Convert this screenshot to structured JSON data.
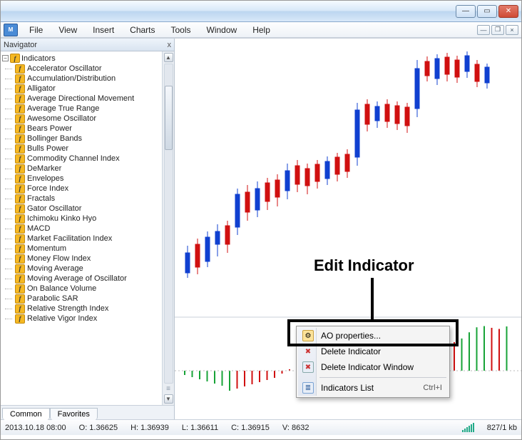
{
  "window": {
    "minimize": "—",
    "maximize": "▭",
    "close": "✕",
    "mdi_min": "—",
    "mdi_restore": "❐",
    "mdi_close": "×"
  },
  "menu": {
    "file": "File",
    "view": "View",
    "insert": "Insert",
    "charts": "Charts",
    "tools": "Tools",
    "window": "Window",
    "help": "Help"
  },
  "navigator": {
    "title": "Navigator",
    "close": "x",
    "root": "Indicators",
    "tabs": {
      "common": "Common",
      "favorites": "Favorites"
    },
    "items": [
      "Accelerator Oscillator",
      "Accumulation/Distribution",
      "Alligator",
      "Average Directional Movement",
      "Average True Range",
      "Awesome Oscillator",
      "Bears Power",
      "Bollinger Bands",
      "Bulls Power",
      "Commodity Channel Index",
      "DeMarker",
      "Envelopes",
      "Force Index",
      "Fractals",
      "Gator Oscillator",
      "Ichimoku Kinko Hyo",
      "MACD",
      "Market Facilitation Index",
      "Momentum",
      "Money Flow Index",
      "Moving Average",
      "Moving Average of Oscillator",
      "On Balance Volume",
      "Parabolic SAR",
      "Relative Strength Index",
      "Relative Vigor Index"
    ]
  },
  "context": {
    "properties": "AO properties...",
    "delete": "Delete Indicator",
    "delete_window": "Delete Indicator Window",
    "list": "Indicators List",
    "list_shortcut": "Ctrl+I"
  },
  "annotation": {
    "label": "Edit Indicator"
  },
  "status": {
    "datetime": "2013.10.18 08:00",
    "open": "O: 1.36625",
    "high": "H: 1.36939",
    "low": "L: 1.36611",
    "close": "C: 1.36915",
    "volume": "V: 8632",
    "conn": "827/1 kb"
  }
}
